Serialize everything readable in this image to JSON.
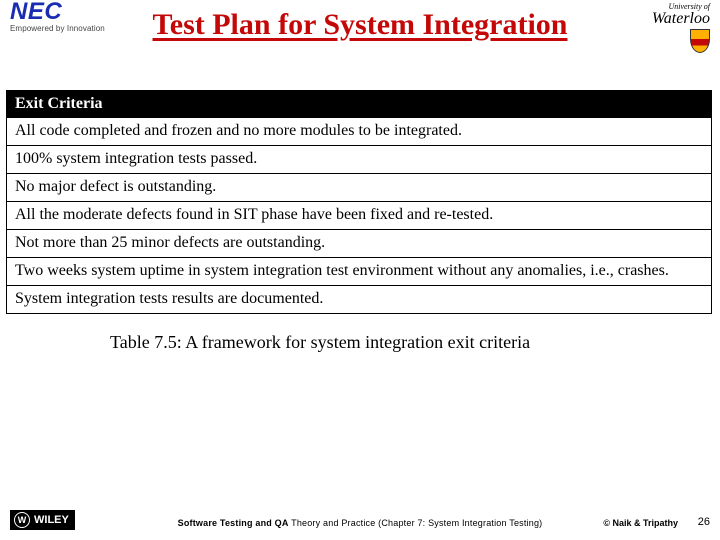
{
  "header": {
    "nec_text": "NEC",
    "nec_tagline": "Empowered by Innovation",
    "title": "Test Plan for System Integration",
    "waterloo_line1": "University of",
    "waterloo_line2": "Waterloo"
  },
  "table": {
    "header": "Exit Criteria",
    "rows": [
      "All code completed and frozen and no more modules to be integrated.",
      "100% system integration tests passed.",
      "No major defect is outstanding.",
      "All the moderate defects found in SIT phase have been fixed and re-tested.",
      "Not more than 25 minor defects are outstanding.",
      "Two weeks system uptime in system integration test environment without any anomalies, i.e., crashes.",
      "System integration tests results are documented."
    ]
  },
  "caption": "Table 7.5: A framework for system integration exit criteria",
  "footer": {
    "wiley": "WILEY",
    "center_bold": "Software Testing and QA",
    "center_rest": " Theory and Practice (Chapter 7: System Integration Testing)",
    "copyright": "© Naik & Tripathy",
    "page": "26"
  }
}
